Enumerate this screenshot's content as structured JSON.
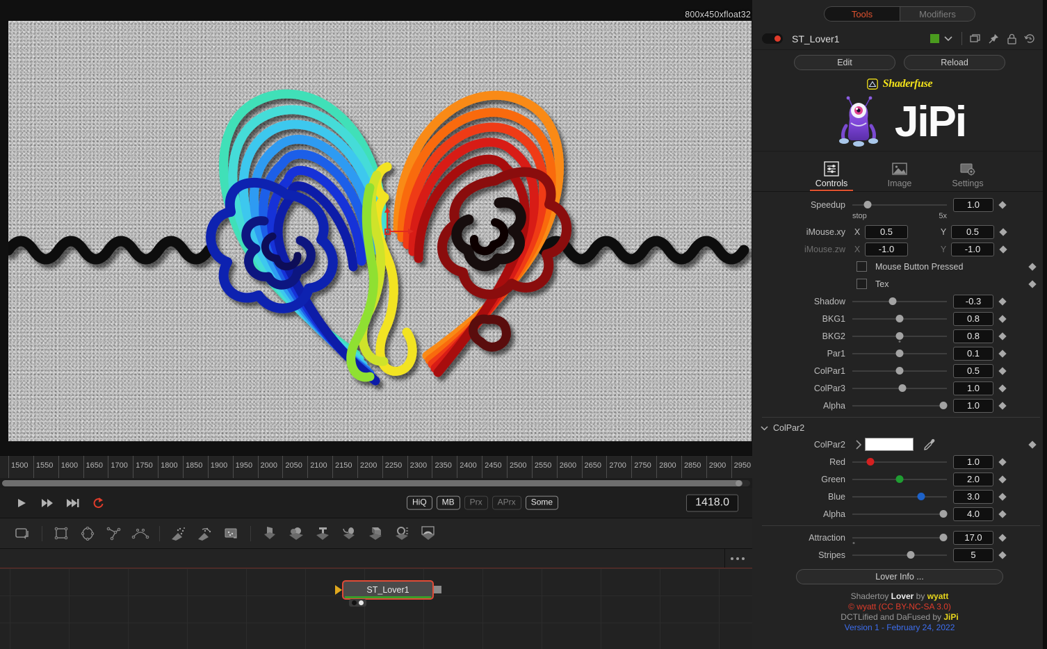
{
  "viewer": {
    "resolution_label": "800x450xfloat32"
  },
  "timeline": {
    "ticks": [
      "1500",
      "1550",
      "1600",
      "1650",
      "1700",
      "1750",
      "1800",
      "1850",
      "1900",
      "1950",
      "2000",
      "2050",
      "2100",
      "2150",
      "2200",
      "2250",
      "2300",
      "2350",
      "2400",
      "2450",
      "2500",
      "2550",
      "2600",
      "2650",
      "2700",
      "2750",
      "2800",
      "2850",
      "2900",
      "2950"
    ],
    "current_frame": "1418.0",
    "quality_buttons": [
      {
        "label": "HiQ",
        "active": true
      },
      {
        "label": "MB",
        "active": true
      },
      {
        "label": "Prx",
        "active": false
      },
      {
        "label": "APrx",
        "active": false
      },
      {
        "label": "Some",
        "active": true
      }
    ]
  },
  "nodegraph": {
    "node_name": "ST_Lover1"
  },
  "panel": {
    "tabs_pill": {
      "tools": "Tools",
      "modifiers": "Modifiers"
    },
    "node_header": {
      "name": "ST_Lover1",
      "color_hex": "#4a9b1e"
    },
    "buttons": {
      "edit": "Edit",
      "reload": "Reload"
    },
    "brand": {
      "shaderfuse": "Shaderfuse",
      "jipi": "JiPi"
    },
    "tabs": [
      {
        "label": "Controls",
        "icon": "sliders-icon",
        "active": true
      },
      {
        "label": "Image",
        "icon": "image-icon",
        "active": false
      },
      {
        "label": "Settings",
        "icon": "settings-icon",
        "active": false
      }
    ],
    "controls": [
      {
        "id": "speedup",
        "label": "Speedup",
        "value": "1.0",
        "pos": 0.16,
        "min_label": "stop",
        "max_label": "5x",
        "knob_color": "#a3a3a3"
      },
      {
        "id": "shadow",
        "label": "Shadow",
        "value": "-0.3",
        "pos": 0.43,
        "knob_color": "#a3a3a3"
      },
      {
        "id": "bkg1",
        "label": "BKG1",
        "value": "0.8",
        "pos": 0.5,
        "knob_color": "#a3a3a3"
      },
      {
        "id": "bkg2",
        "label": "BKG2",
        "value": "0.8",
        "pos": 0.5,
        "knob_color": "#a3a3a3",
        "tickdot": 0.5
      },
      {
        "id": "par1",
        "label": "Par1",
        "value": "0.1",
        "pos": 0.5,
        "knob_color": "#a3a3a3"
      },
      {
        "id": "colpar1",
        "label": "ColPar1",
        "value": "0.5",
        "pos": 0.5,
        "knob_color": "#a3a3a3"
      },
      {
        "id": "colpar3",
        "label": "ColPar3",
        "value": "1.0",
        "pos": 0.53,
        "knob_color": "#a3a3a3"
      },
      {
        "id": "alpha1",
        "label": "Alpha",
        "value": "1.0",
        "pos": 0.96,
        "knob_color": "#a3a3a3"
      }
    ],
    "imouse_xy": {
      "label": "iMouse.xy",
      "x_axis": "X",
      "y_axis": "Y",
      "x": "0.5",
      "y": "0.5"
    },
    "imouse_zw": {
      "label": "iMouse.zw",
      "x_axis": "X",
      "y_axis": "Y",
      "x": "-1.0",
      "y": "-1.0"
    },
    "checkboxes": [
      {
        "id": "mouse-button-pressed",
        "label": "Mouse Button Pressed",
        "checked": false
      },
      {
        "id": "tex",
        "label": "Tex",
        "checked": false
      }
    ],
    "colpar2_group": {
      "title": "ColPar2",
      "swatch_label": "ColPar2",
      "swatch_color": "#ffffff",
      "channels": [
        {
          "id": "red",
          "label": "Red",
          "value": "1.0",
          "pos": 0.19,
          "knob_color": "#d42020"
        },
        {
          "id": "green",
          "label": "Green",
          "value": "2.0",
          "pos": 0.5,
          "knob_color": "#1f9d32"
        },
        {
          "id": "blue",
          "label": "Blue",
          "value": "3.0",
          "pos": 0.73,
          "knob_color": "#1d62c9"
        },
        {
          "id": "alpha2",
          "label": "Alpha",
          "value": "4.0",
          "pos": 0.96,
          "knob_color": "#a3a3a3"
        }
      ]
    },
    "extra_controls": [
      {
        "id": "attraction",
        "label": "Attraction",
        "value": "17.0",
        "pos": 0.96,
        "knob_color": "#a3a3a3",
        "tickdot": 0.015
      },
      {
        "id": "stripes",
        "label": "Stripes",
        "value": "5",
        "pos": 0.62,
        "knob_color": "#a3a3a3"
      }
    ],
    "info_button": "Lover Info ...",
    "credits": {
      "line1_a": "Shadertoy ",
      "line1_b": "Lover",
      "line1_c": " by ",
      "line1_d": "wyatt",
      "line2": "© wyatt (CC BY-NC-SA 3.0)",
      "line3_a": "DCTLified and DaFused by ",
      "line3_b": "JiPi",
      "line4": "Version 1 - February 24, 2022"
    }
  }
}
